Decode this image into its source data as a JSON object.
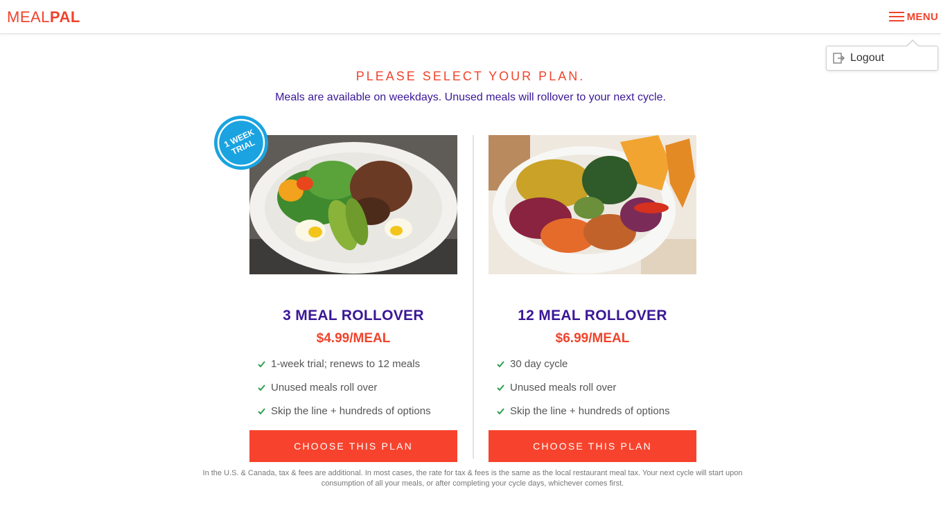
{
  "header": {
    "logo_part1": "MEAL",
    "logo_part2": "PAL",
    "menu_label": "MENU"
  },
  "dropdown": {
    "logout_label": "Logout",
    "icon": "logout-icon"
  },
  "page": {
    "title": "PLEASE SELECT YOUR PLAN.",
    "subtitle": "Meals are available on weekdays. Unused meals will rollover to your next cycle."
  },
  "plans": [
    {
      "badge": [
        "1 WEEK",
        "TRIAL"
      ],
      "name": "3 MEAL ROLLOVER",
      "price": "$4.99/MEAL",
      "features": [
        "1-week trial; renews to 12 meals",
        "Unused meals roll over",
        "Skip the line + hundreds of options"
      ],
      "button_label": "CHOOSE THIS PLAN"
    },
    {
      "name": "12 MEAL ROLLOVER",
      "price": "$6.99/MEAL",
      "features": [
        "30 day cycle",
        "Unused meals roll over",
        "Skip the line + hundreds of options"
      ],
      "button_label": "CHOOSE THIS PLAN"
    }
  ],
  "footnote": "In the U.S. & Canada, tax & fees are additional. In most cases, the rate for tax & fees is the same as the local restaurant meal tax. Your next cycle will start upon consumption of all your meals, or after completing your cycle days, whichever comes first.",
  "colors": {
    "brand": "#f0432c",
    "heading_purple": "#3a1796",
    "button": "#f7432d",
    "badge": "#1aa3e0",
    "check": "#2e9e4f"
  }
}
